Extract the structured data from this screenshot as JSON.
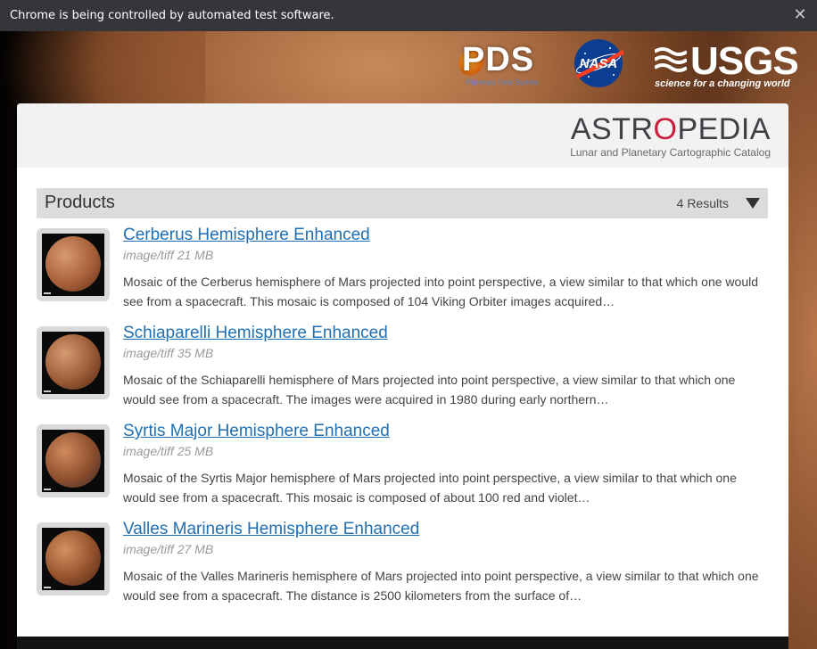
{
  "browser": {
    "infobar_text": "Chrome is being controlled by automated test software.",
    "close_glyph": "✕"
  },
  "logos": {
    "pds": {
      "text": "PDS",
      "subtitle": "Planetary Data System"
    },
    "nasa": {
      "text": "NASA"
    },
    "usgs": {
      "text": "USGS",
      "tagline": "science for a changing world"
    }
  },
  "header": {
    "logo_text": "ASTROPEDIA",
    "subtitle": "Lunar and Planetary Cartographic Catalog"
  },
  "products": {
    "title": "Products",
    "count": "4 Results",
    "toggle_icon": "caret-down-icon",
    "items": [
      {
        "title": "Cerberus Hemisphere Enhanced",
        "meta": "image/tiff 21 MB",
        "description": "Mosaic of the Cerberus hemisphere of Mars projected into point perspective, a view similar to that which one would see from a spacecraft. This mosaic is composed of 104 Viking Orbiter images acquired…",
        "colors": {
          "light": "#d89a6e",
          "mid": "#a8603a",
          "dark": "#5e2e17"
        }
      },
      {
        "title": "Schiaparelli Hemisphere Enhanced",
        "meta": "image/tiff 35 MB",
        "description": "Mosaic of the Schiaparelli hemisphere of Mars projected into point perspective, a view similar to that which one would see from a spacecraft. The images were acquired in 1980 during early northern…",
        "colors": {
          "light": "#d49a70",
          "mid": "#9a5a36",
          "dark": "#4e2713"
        }
      },
      {
        "title": "Syrtis Major Hemisphere Enhanced",
        "meta": "image/tiff 25 MB",
        "description": "Mosaic of the Syrtis Major hemisphere of Mars projected into point perspective, a view similar to that which one would see from a spacecraft. This mosaic is composed of about 100 red and violet…",
        "colors": {
          "light": "#d08a5c",
          "mid": "#8e4f2e",
          "dark": "#3e2a2a"
        }
      },
      {
        "title": "Valles Marineris Hemisphere Enhanced",
        "meta": "image/tiff 27 MB",
        "description": "Mosaic of the Valles Marineris hemisphere of Mars projected into point perspective, a view similar to that which one would see from a spacecraft. The distance is 2500 kilometers from the surface of…",
        "colors": {
          "light": "#d2925f",
          "mid": "#94522d",
          "dark": "#4a2412"
        }
      }
    ]
  },
  "colors": {
    "link": "#1f6fb2",
    "infobar_bg": "#35363a",
    "bar_bg": "#dcdcdc",
    "astropedia_accent": "#c8203c"
  }
}
